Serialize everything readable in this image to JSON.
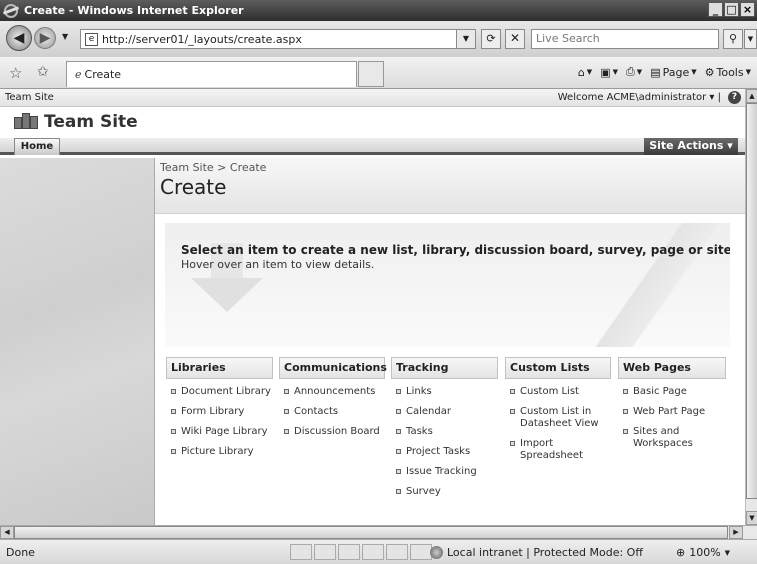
{
  "window": {
    "title": "Create - Windows Internet Explorer",
    "buttons": [
      "_",
      "□",
      "×"
    ]
  },
  "browser": {
    "url": "http://server01/_layouts/create.aspx",
    "search_placeholder": "Live Search",
    "tab_title": "Create",
    "commands": {
      "page": "Page",
      "tools": "Tools"
    }
  },
  "sharepoint": {
    "top_breadcrumb": "Team Site",
    "welcome": "Welcome ACME\\administrator",
    "site_title": "Team Site",
    "home_tab": "Home",
    "site_actions": "Site Actions"
  },
  "page": {
    "breadcrumb": "Team Site > Create",
    "title": "Create",
    "headline": "Select an item to create a new list, library, discussion board, survey, page or site.",
    "subline": "Hover over an item to view details."
  },
  "columns": [
    {
      "header": "Libraries",
      "items": [
        "Document Library",
        "Form Library",
        "Wiki Page Library",
        "Picture Library"
      ]
    },
    {
      "header": "Communications",
      "items": [
        "Announcements",
        "Contacts",
        "Discussion Board"
      ]
    },
    {
      "header": "Tracking",
      "items": [
        "Links",
        "Calendar",
        "Tasks",
        "Project Tasks",
        "Issue Tracking",
        "Survey"
      ]
    },
    {
      "header": "Custom Lists",
      "items": [
        "Custom List",
        "Custom List in Datasheet View",
        "Import Spreadsheet"
      ]
    },
    {
      "header": "Web Pages",
      "items": [
        "Basic Page",
        "Web Part Page",
        "Sites and Workspaces"
      ]
    }
  ],
  "status": {
    "text": "Done",
    "zone": "Local intranet | Protected Mode: Off",
    "zoom": "100%"
  },
  "icons": {
    "back": "back-arrow-icon",
    "forward": "forward-arrow-icon",
    "home": "home-icon",
    "feeds": "feeds-icon",
    "print": "print-icon",
    "help": "help-icon",
    "globe": "globe-icon"
  }
}
